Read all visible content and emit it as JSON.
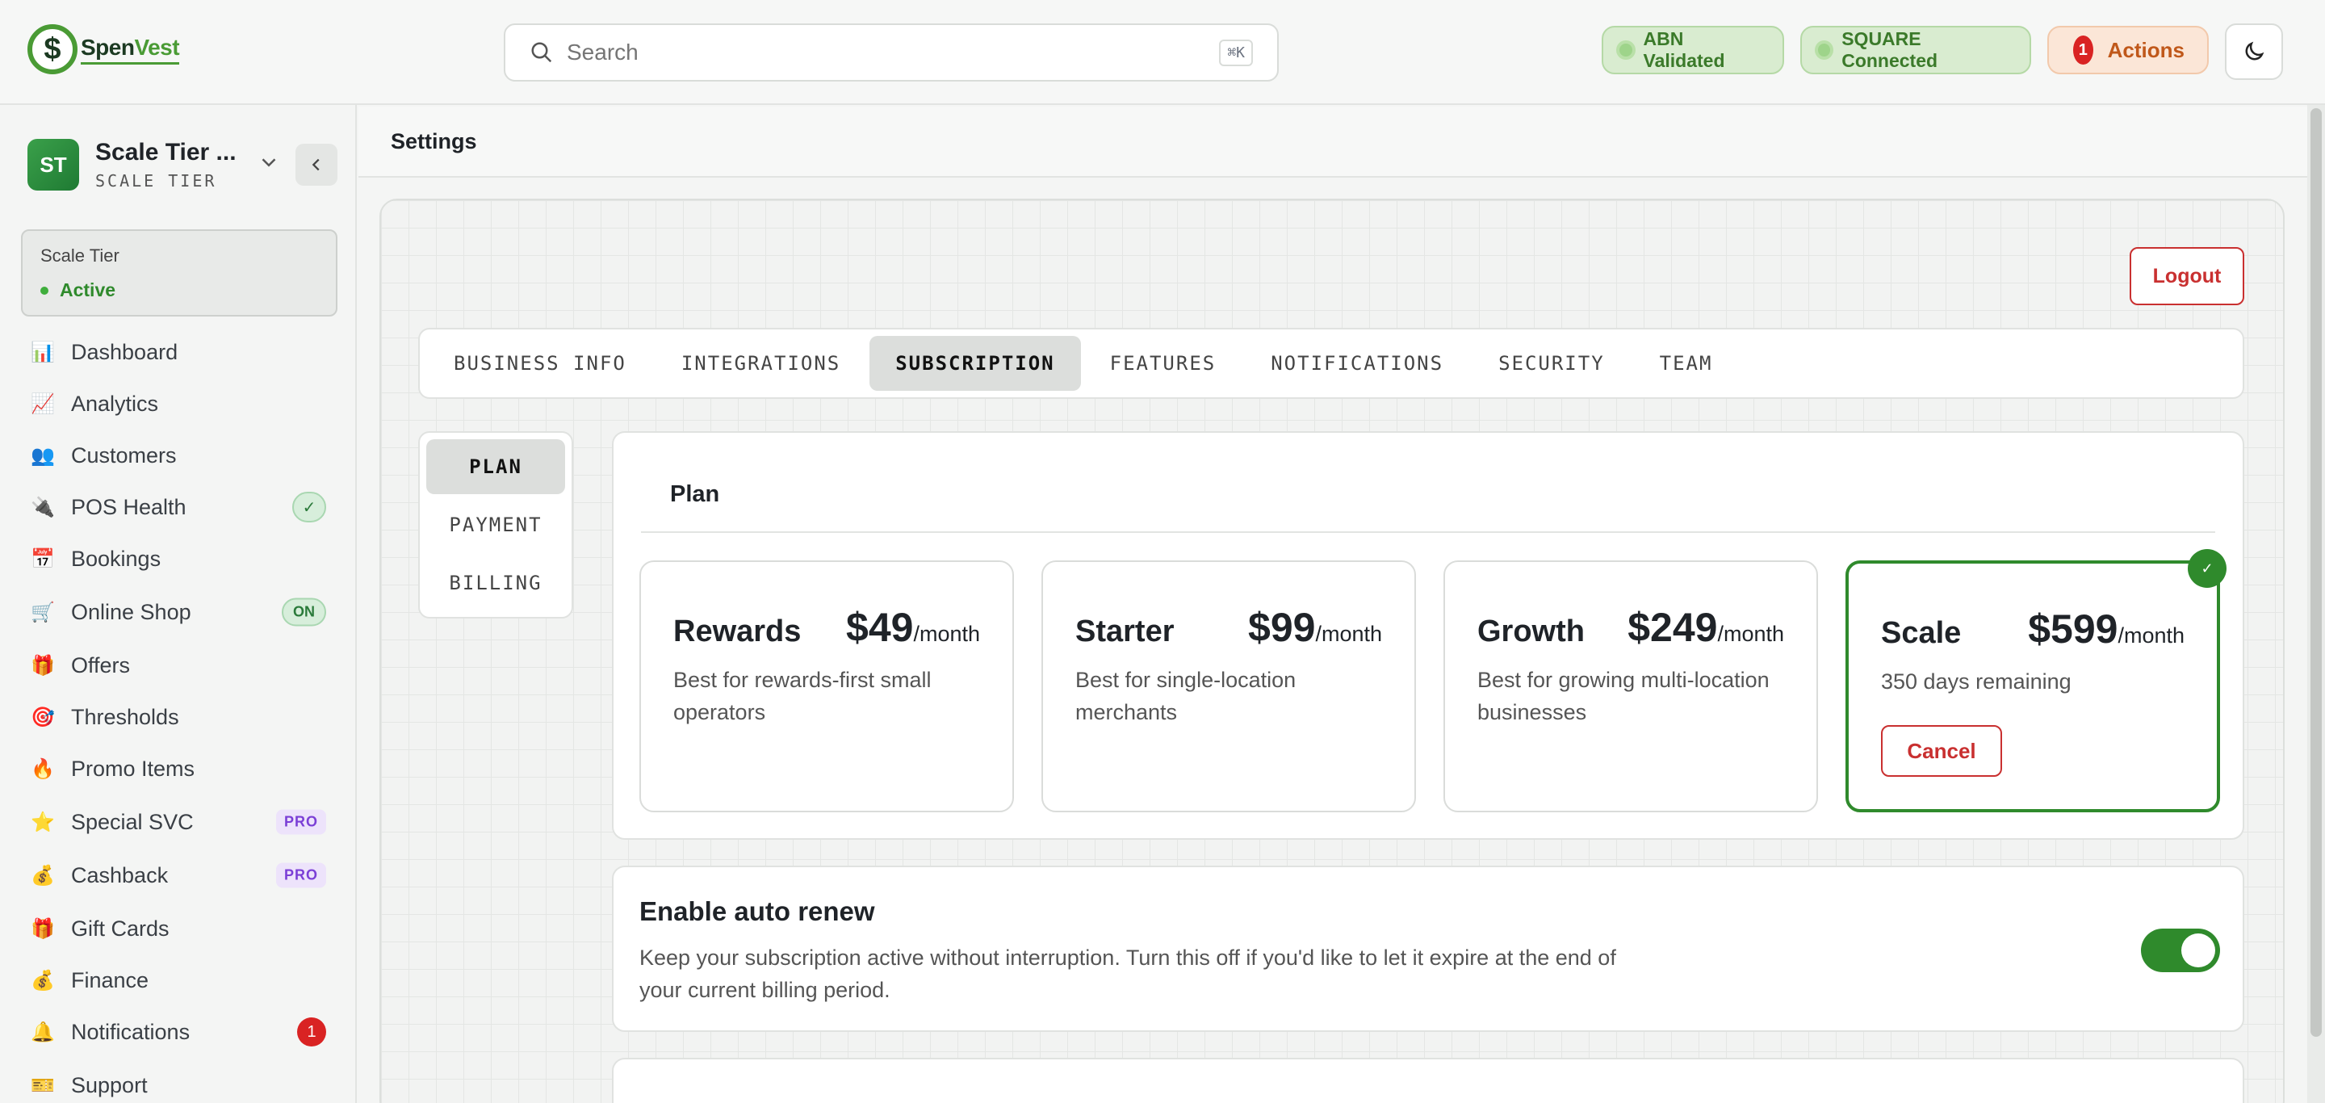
{
  "app": {
    "logo_prefix": "Spen",
    "logo_suffix": "Vest",
    "logo_symbol": "$"
  },
  "search": {
    "placeholder": "Search",
    "shortcut": "⌘K"
  },
  "status": {
    "abn": "ABN Validated",
    "square": "SQUARE Connected",
    "actions_label": "Actions",
    "actions_count": "1"
  },
  "account": {
    "initials": "ST",
    "name": "Scale Tier ...",
    "tier": "SCALE TIER"
  },
  "tier_box": {
    "label": "Scale Tier",
    "status": "Active"
  },
  "sidebar": {
    "items": [
      {
        "label": "Dashboard",
        "icon": "📊"
      },
      {
        "label": "Analytics",
        "icon": "📈"
      },
      {
        "label": "Customers",
        "icon": "👥"
      },
      {
        "label": "POS Health",
        "icon": "🔌",
        "badge": "✓"
      },
      {
        "label": "Bookings",
        "icon": "📅"
      },
      {
        "label": "Online Shop",
        "icon": "🛒",
        "badge": "ON"
      },
      {
        "label": "Offers",
        "icon": "🎁"
      },
      {
        "label": "Thresholds",
        "icon": "🎯"
      },
      {
        "label": "Promo Items",
        "icon": "🔥"
      },
      {
        "label": "Special SVC",
        "icon": "⭐",
        "badge": "PRO"
      },
      {
        "label": "Cashback",
        "icon": "💰",
        "badge": "PRO"
      },
      {
        "label": "Gift Cards",
        "icon": "🎁"
      },
      {
        "label": "Finance",
        "icon": "💰"
      },
      {
        "label": "Notifications",
        "icon": "🔔",
        "badge": "1"
      },
      {
        "label": "Support",
        "icon": "🎫"
      }
    ]
  },
  "page": {
    "title": "Settings",
    "logout": "Logout"
  },
  "tabs": [
    "BUSINESS INFO",
    "INTEGRATIONS",
    "SUBSCRIPTION",
    "FEATURES",
    "NOTIFICATIONS",
    "SECURITY",
    "TEAM"
  ],
  "active_tab": "SUBSCRIPTION",
  "subnav": [
    "PLAN",
    "PAYMENT",
    "BILLING"
  ],
  "plan": {
    "heading": "Plan",
    "per_month": "/month",
    "tiers": [
      {
        "name": "Rewards",
        "price": "$49",
        "desc": "Best for rewards-first small operators"
      },
      {
        "name": "Starter",
        "price": "$99",
        "desc": "Best for single-location merchants"
      },
      {
        "name": "Growth",
        "price": "$249",
        "desc": "Best for growing multi-location businesses"
      },
      {
        "name": "Scale",
        "price": "$599",
        "desc": "350 days remaining",
        "current": true,
        "action": "Cancel"
      }
    ]
  },
  "auto_renew": {
    "title": "Enable auto renew",
    "description": "Keep your subscription active without interruption. Turn this off if you'd like to let it expire at the end of your current billing period.",
    "enabled": true
  },
  "colors": {
    "brand_green": "#2f8a2c",
    "danger": "#c93030",
    "pro_purple": "#7b3fd6"
  }
}
